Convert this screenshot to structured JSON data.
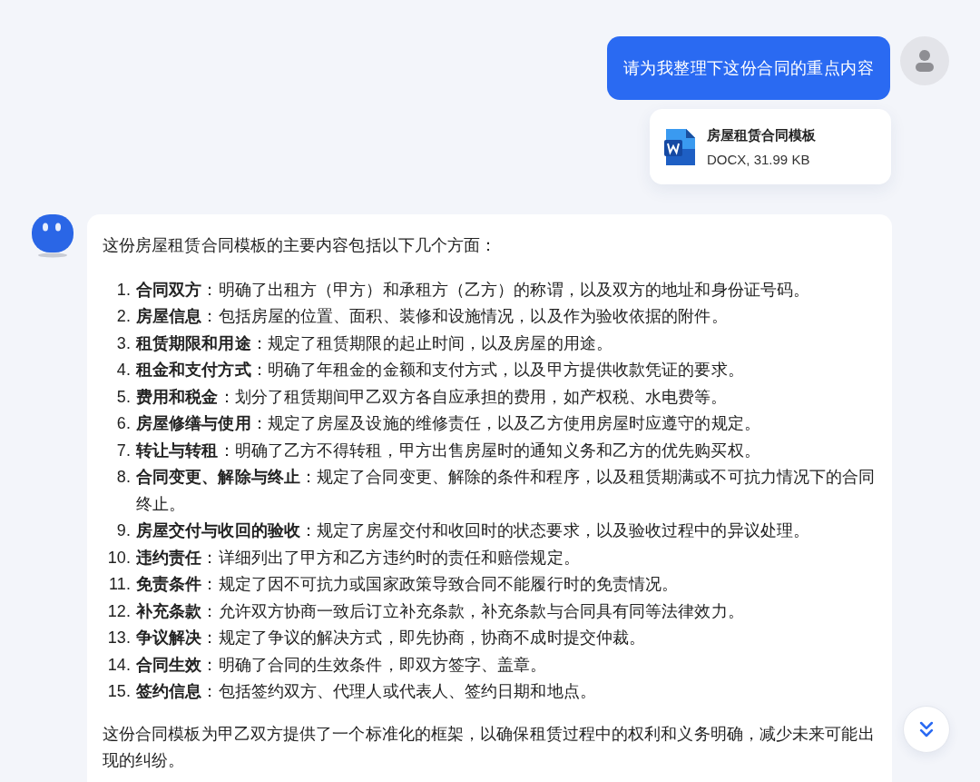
{
  "user_message": {
    "text": "请为我整理下这份合同的重点内容"
  },
  "attachment": {
    "name": "房屋租赁合同模板",
    "meta": "DOCX, 31.99 KB"
  },
  "reply": {
    "intro": "这份房屋租赁合同模板的主要内容包括以下几个方面：",
    "items": [
      {
        "number": "1.",
        "text": "**合同双方**：明确了出租方（甲方）和承租方（乙方）的称谓，以及双方的地址和身份证号码。"
      },
      {
        "number": "2.",
        "text": "**房屋信息**：包括房屋的位置、面积、装修和设施情况，以及作为验收依据的附件。"
      },
      {
        "number": "3.",
        "text": "**租赁期限和用途**：规定了租赁期限的起止时间，以及房屋的用途。"
      },
      {
        "number": "4.",
        "text": "**租金和支付方式**：明确了年租金的金额和支付方式，以及甲方提供收款凭证的要求。"
      },
      {
        "number": "5.",
        "text": "**费用和税金**：划分了租赁期间甲乙双方各自应承担的费用，如产权税、水电费等。"
      },
      {
        "number": "6.",
        "text": "**房屋修缮与使用**：规定了房屋及设施的维修责任，以及乙方使用房屋时应遵守的规定。"
      },
      {
        "number": "7.",
        "text": "**转让与转租**：明确了乙方不得转租，甲方出售房屋时的通知义务和乙方的优先购买权。"
      },
      {
        "number": "8.",
        "text": "**合同变更、解除与终止**：规定了合同变更、解除的条件和程序，以及租赁期满或不可抗力情况下的合同终止。"
      },
      {
        "number": "9.",
        "text": "**房屋交付与收回的验收**：规定了房屋交付和收回时的状态要求，以及验收过程中的异议处理。"
      },
      {
        "number": "10.",
        "text": "**违约责任**：详细列出了甲方和乙方违约时的责任和赔偿规定。"
      },
      {
        "number": "11.",
        "text": "**免责条件**：规定了因不可抗力或国家政策导致合同不能履行时的免责情况。"
      },
      {
        "number": "12.",
        "text": "**补充条款**：允许双方协商一致后订立补充条款，补充条款与合同具有同等法律效力。"
      },
      {
        "number": "13.",
        "text": "**争议解决**：规定了争议的解决方式，即先协商，协商不成时提交仲裁。"
      },
      {
        "number": "14.",
        "text": "**合同生效**：明确了合同的生效条件，即双方签字、盖章。"
      },
      {
        "number": "15.",
        "text": "**签约信息**：包括签约双方、代理人或代表人、签约日期和地点。"
      }
    ],
    "conclusion": "这份合同模板为甲乙双方提供了一个标准化的框架，以确保租赁过程中的权利和义务明确，减少未来可能出现的纠纷。"
  }
}
